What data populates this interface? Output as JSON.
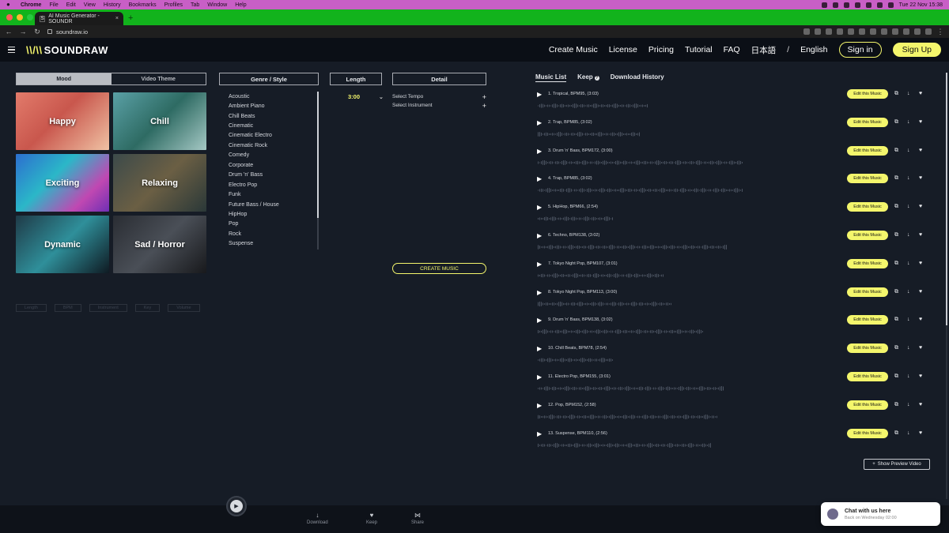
{
  "colors": {
    "accent": "#f4f66c",
    "menubar": "#c85fc6",
    "tabstrip": "#12b31c",
    "bg": "#161c26"
  },
  "macos": {
    "app": "Chrome",
    "menus": [
      "File",
      "Edit",
      "View",
      "History",
      "Bookmarks",
      "Profiles",
      "Tab",
      "Window",
      "Help"
    ],
    "clock": "Tue 22 Nov  15:38"
  },
  "browser": {
    "tab_title": "AI Music Generator - SOUNDR",
    "tab_favicon": "S",
    "url": "soundraw.io"
  },
  "header": {
    "logo": "SOUNDRAW",
    "logo_mark": "\\\\/\\\\",
    "nav": [
      "Create Music",
      "License",
      "Pricing",
      "Tutorial",
      "FAQ"
    ],
    "lang_jp": "日本語",
    "lang_slash": "/",
    "lang_en": "English",
    "sign_in": "Sign in",
    "sign_up": "Sign Up"
  },
  "left": {
    "tabs": [
      "Mood",
      "Video Theme"
    ],
    "moods": [
      {
        "label": "Happy"
      },
      {
        "label": "Chill"
      },
      {
        "label": "Exciting"
      },
      {
        "label": "Relaxing"
      },
      {
        "label": "Dynamic"
      },
      {
        "label": "Sad / Horror"
      }
    ],
    "headers": {
      "genre": "Genre / Style",
      "length": "Length",
      "detail": "Detail"
    },
    "genres": [
      "Acoustic",
      "Ambient Piano",
      "Chill Beats",
      "Cinematic",
      "Cinematic Electro",
      "Cinematic Rock",
      "Comedy",
      "Corporate",
      "Drum 'n' Bass",
      "Electro Pop",
      "Funk",
      "Future Bass / House",
      "HipHop",
      "Pop",
      "Rock",
      "Suspense"
    ],
    "length_value": "3:00",
    "details": [
      "Select Tempo",
      "Select Instrument"
    ],
    "create_button": "CREATE MUSIC",
    "ghost": [
      "Length",
      "BPM",
      "Instrument",
      "Key",
      "Volume"
    ]
  },
  "music": {
    "tabs": [
      "Music List",
      "Keep",
      "Download History"
    ],
    "edit_label": "Edit this Music",
    "tracks": [
      "1. Tropical, BPM95, (3:03)",
      "2. Trap, BPM85, (3:02)",
      "3. Drum 'n' Bass, BPM172, (3:00)",
      "4. Trap, BPM85, (3:02)",
      "5. HipHop, BPM66, (2:54)",
      "6. Techno, BPM138, (3:02)",
      "7. Tokyo Night Pop, BPM107, (3:01)",
      "8. Tokyo Night Pop, BPM113, (3:00)",
      "9. Drum 'n' Bass, BPM138, (3:02)",
      "10. Chill Beats, BPM78, (2:54)",
      "11. Electro Pop, BPM155, (3:01)",
      "12. Pop, BPM152, (2:58)",
      "13. Suspense, BPM110, (2:56)"
    ],
    "preview_button": "Show Preview Video"
  },
  "player": {
    "download": "Download",
    "keep": "Keep",
    "share": "Share"
  },
  "chat": {
    "title": "Chat with us here",
    "subtitle": "Back on Wednesday 02:00"
  }
}
